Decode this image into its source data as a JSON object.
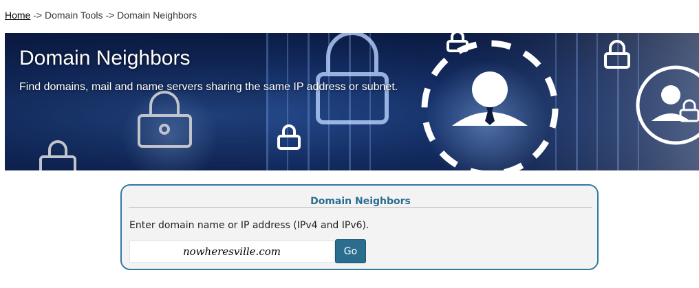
{
  "breadcrumb": {
    "home": "Home",
    "sep1": "->",
    "tools": "Domain Tools",
    "sep2": "->",
    "current": "Domain Neighbors"
  },
  "banner": {
    "title": "Domain Neighbors",
    "subtitle": "Find domains, mail and name servers sharing the same IP address or subnet."
  },
  "tool": {
    "title": "Domain Neighbors",
    "prompt": "Enter domain name or IP address (IPv4 and IPv6).",
    "input_value": "nowheresville.com",
    "go_label": "Go"
  },
  "colors": {
    "accent": "#2a6d8f",
    "box_border": "#2e7aa0",
    "box_background": "#f3f3f3"
  }
}
